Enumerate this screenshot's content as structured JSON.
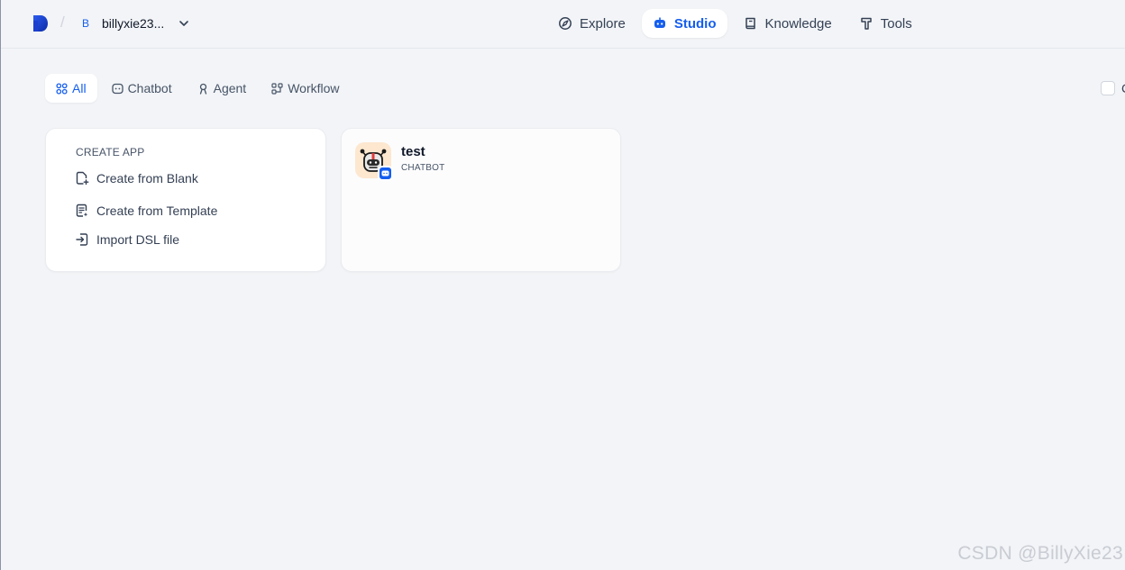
{
  "header": {
    "workspace_initial": "B",
    "workspace_name": "billyxie23...",
    "nav": [
      {
        "label": "Explore",
        "icon": "compass-icon",
        "active": false
      },
      {
        "label": "Studio",
        "icon": "robot-icon",
        "active": true
      },
      {
        "label": "Knowledge",
        "icon": "book-icon",
        "active": false
      },
      {
        "label": "Tools",
        "icon": "hammer-icon",
        "active": false
      }
    ]
  },
  "tabs": [
    {
      "label": "All",
      "icon": "grid-icon",
      "active": true
    },
    {
      "label": "Chatbot",
      "icon": "chat-icon",
      "active": false
    },
    {
      "label": "Agent",
      "icon": "agent-icon",
      "active": false
    },
    {
      "label": "Workflow",
      "icon": "workflow-icon",
      "active": false
    }
  ],
  "right_filter": {
    "label": "C"
  },
  "create_card": {
    "title": "CREATE APP",
    "items": [
      {
        "label": "Create from Blank",
        "icon": "file-plus-icon"
      },
      {
        "label": "Create from Template",
        "icon": "template-icon"
      },
      {
        "label": "Import DSL file",
        "icon": "import-icon"
      }
    ]
  },
  "apps": [
    {
      "name": "test",
      "type": "CHATBOT",
      "icon": "robot-avatar-icon",
      "badge_icon": "chatbot-badge-icon"
    }
  ],
  "watermark": "CSDN @BillyXie23",
  "colors": {
    "accent": "#155eef",
    "background": "#f2f4f7",
    "card": "#ffffff",
    "app_icon_bg": "#fde7cf"
  }
}
